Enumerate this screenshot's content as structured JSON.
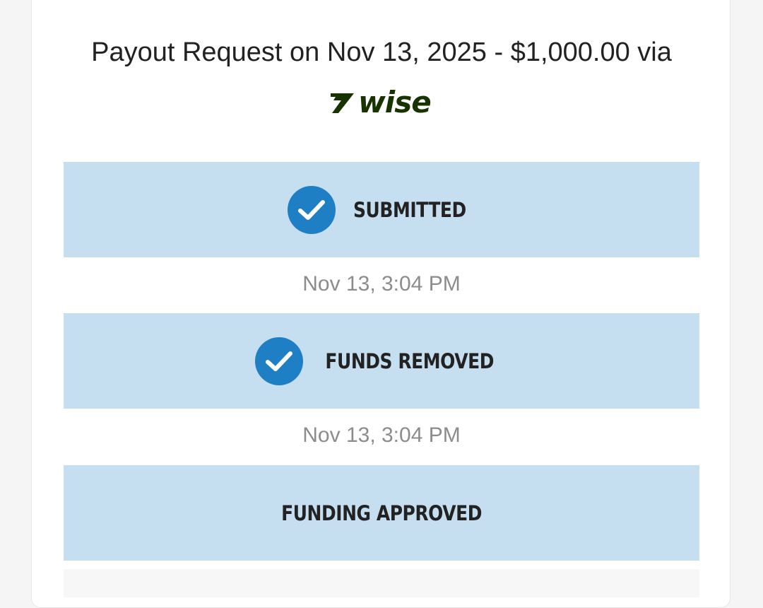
{
  "payout": {
    "title": "Payout Request on Nov 13, 2025 - $1,000.00 via",
    "provider_logo": {
      "text": "WISE",
      "color": "#163300",
      "icon": "wise-flag-logo"
    }
  },
  "colors": {
    "step_background": "#c5dff0",
    "check_circle": "#1f7fc4",
    "timestamp_text": "#8c8c8c",
    "label_text": "#222222"
  },
  "steps": [
    {
      "label": "SUBMITTED",
      "completed": true,
      "icon": "check-circle-icon",
      "timestamp": "Nov 13, 3:04 PM"
    },
    {
      "label": "FUNDS REMOVED",
      "completed": true,
      "icon": "check-circle-icon",
      "timestamp": "Nov 13, 3:04 PM"
    },
    {
      "label": "FUNDING APPROVED",
      "completed": false
    }
  ]
}
